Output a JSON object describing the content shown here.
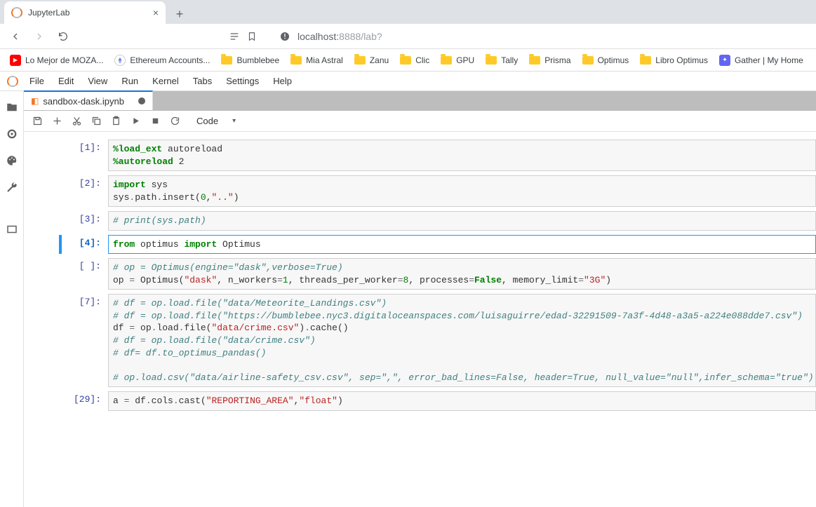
{
  "browser": {
    "tab_title": "JupyterLab",
    "url_host": "localhost:",
    "url_port_path": "8888/lab?",
    "bookmarks": [
      {
        "label": "Lo Mejor de MOZA...",
        "icon": "youtube"
      },
      {
        "label": "Ethereum Accounts...",
        "icon": "eth"
      },
      {
        "label": "Bumblebee",
        "icon": "folder"
      },
      {
        "label": "Mia Astral",
        "icon": "folder"
      },
      {
        "label": "Zanu",
        "icon": "folder"
      },
      {
        "label": "Clic",
        "icon": "folder"
      },
      {
        "label": "GPU",
        "icon": "folder"
      },
      {
        "label": "Tally",
        "icon": "folder"
      },
      {
        "label": "Prisma",
        "icon": "folder"
      },
      {
        "label": "Optimus",
        "icon": "folder"
      },
      {
        "label": "Libro Optimus",
        "icon": "folder"
      },
      {
        "label": "Gather | My Home",
        "icon": "gather"
      }
    ]
  },
  "menubar": [
    "File",
    "Edit",
    "View",
    "Run",
    "Kernel",
    "Tabs",
    "Settings",
    "Help"
  ],
  "doc_tab": {
    "filename": "sandbox-dask.ipynb"
  },
  "cell_type_label": "Code",
  "cells": [
    {
      "prompt": "[1]:",
      "active": false,
      "html": "<span class='mag'>%load_ext</span> autoreload\n<span class='mag'>%autoreload</span> 2"
    },
    {
      "prompt": "[2]:",
      "active": false,
      "html": "<span class='kw'>import</span> sys\nsys<span class='op'>.</span>path<span class='op'>.</span>insert(<span class='num'>0</span>,<span class='s'>\"..\"</span>)"
    },
    {
      "prompt": "[3]:",
      "active": false,
      "html": "<span class='c'># print(sys.path)</span>"
    },
    {
      "prompt": "[4]:",
      "active": true,
      "html": "<span class='kw'>from</span> optimus <span class='kw'>import</span> Optimus"
    },
    {
      "prompt": "[ ]:",
      "active": false,
      "html": "<span class='c'># op = Optimus(engine=\"dask\",verbose=True)</span>\nop <span class='op'>=</span> Optimus(<span class='s'>\"dask\"</span>, n_workers<span class='op'>=</span><span class='num'>1</span>, threads_per_worker<span class='op'>=</span><span class='num'>8</span>, processes<span class='op'>=</span><span class='bool'>False</span>, memory_limit<span class='op'>=</span><span class='s'>\"3G\"</span>)"
    },
    {
      "prompt": "[7]:",
      "active": false,
      "html": "<span class='c'># df = op.load.file(\"data/Meteorite_Landings.csv\")</span>\n<span class='c'># df = op.load.file(\"https://bumblebee.nyc3.digitaloceanspaces.com/luisaguirre/edad-32291509-7a3f-4d48-a3a5-a224e088dde7.csv\")</span>\ndf <span class='op'>=</span> op<span class='op'>.</span>load<span class='op'>.</span>file(<span class='s'>\"data/crime.csv\"</span>)<span class='op'>.</span>cache()\n<span class='c'># df = op.load.file(\"data/crime.csv\")</span>\n<span class='c'># df= df.to_optimus_pandas()</span>\n\n<span class='c'># op.load.csv(\"data/airline-safety_csv.csv\", sep=\",\", error_bad_lines=False, header=True, null_value=\"null\",infer_schema=\"true\").ext.cache()</span>"
    },
    {
      "prompt": "[29]:",
      "active": false,
      "html": "a <span class='op'>=</span> df<span class='op'>.</span>cols<span class='op'>.</span>cast(<span class='s'>\"REPORTING_AREA\"</span>,<span class='s'>\"float\"</span>)"
    }
  ]
}
